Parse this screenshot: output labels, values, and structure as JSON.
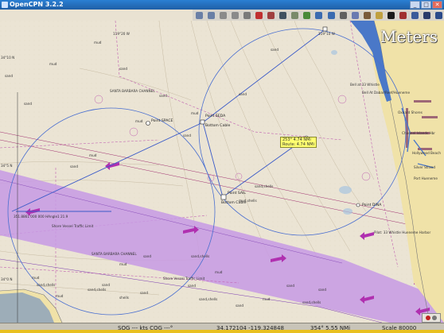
{
  "window": {
    "title": "OpenCPN 3.2.2",
    "controls": [
      "_",
      "□",
      "✕"
    ]
  },
  "toolbar": {
    "buttons": [
      {
        "name": "zoom-in-icon",
        "color": "#6a7fa6"
      },
      {
        "name": "zoom-out-icon",
        "color": "#6a7fa6"
      },
      {
        "name": "scale-in-icon",
        "color": "#8a8a8a"
      },
      {
        "name": "scale-out-icon",
        "color": "#8a8a8a"
      },
      {
        "name": "anchor-icon",
        "color": "#7a7a7a"
      },
      {
        "name": "route-icon",
        "color": "#c03030"
      },
      {
        "name": "follow-icon",
        "color": "#a04040"
      },
      {
        "name": "track-icon",
        "color": "#405060"
      },
      {
        "name": "text-icon",
        "color": "#7a8a6a"
      },
      {
        "name": "settings-icon",
        "color": "#4a8a3a"
      },
      {
        "name": "chart-icon",
        "color": "#3a6ab0"
      },
      {
        "name": "globe-icon",
        "color": "#3a6ab0"
      },
      {
        "name": "print-icon",
        "color": "#606060"
      },
      {
        "name": "route-manager-icon",
        "color": "#6a7ab0"
      },
      {
        "name": "ais-icon",
        "color": "#7a5a3a"
      },
      {
        "name": "tide-icon",
        "color": "#c0a040"
      },
      {
        "name": "current-icon",
        "color": "#1a1a1a"
      },
      {
        "name": "colorscheme-icon",
        "color": "#a03030"
      },
      {
        "name": "help-icon",
        "color": "#3a5a9a"
      },
      {
        "name": "quit-icon",
        "color": "#2a3a6a"
      },
      {
        "name": "ais-alert-icon",
        "color": "#2a4a8a"
      }
    ]
  },
  "chart": {
    "units_overlay": "Meters",
    "route_popup": {
      "line1": "253° 4.74 NMi",
      "line2": "Route: 4.74 NMi"
    },
    "waypoints": [
      {
        "label": "Point SEDA"
      },
      {
        "label": "Bottom Cable"
      },
      {
        "label": "Point SPACE"
      },
      {
        "label": "Point SAIL"
      },
      {
        "label": "Bottom Cable"
      },
      {
        "label": "Point DINA"
      }
    ],
    "depth_labels": [
      "mud",
      "mud",
      "sand",
      "sand",
      "sand",
      "mud",
      "sand",
      "mud",
      "sand",
      "mud",
      "sand,shells",
      "sand,shells",
      "sand",
      "mud",
      "shells",
      "sand",
      "sand",
      "sand,shells",
      "sand",
      "mud",
      "sand",
      "sand,shells",
      "sand",
      "mud",
      "sand",
      "sand",
      "sand",
      "mud,shells",
      "sand,shells",
      "sand",
      "mud",
      "sand,shells",
      "mud"
    ],
    "area_labels": [
      "SANTA BARBARA CHANNEL",
      "SANTA BARBARA CHANNEL",
      "Shore Vessel Traffic Limit",
      "Shore Vessel Traffic Limit",
      "Bell at 33 Whistle",
      "Pilot: 33 Whistle Hueneme Harbor",
      "Bell At Dabar/Reef/Hueneme",
      "Oxnard Shores",
      "Channel Islands Hbr",
      "Hollywood Beach",
      "Silver Strand",
      "Port Hueneme"
    ],
    "cursor_note": "351.8861 000 000  HAngle1 21.9",
    "lat_ticks": [
      "34°10 N",
      "34°5 N",
      "34°0 N"
    ],
    "lon_ticks": [
      "119°20 W",
      "119°10 W"
    ]
  },
  "statusbar": {
    "sog": "SOG --- kts   COG ---°",
    "position": "34.172104    -119.324848",
    "bearing": "354°   5.55 NMi",
    "scale": "Scale 80000"
  }
}
